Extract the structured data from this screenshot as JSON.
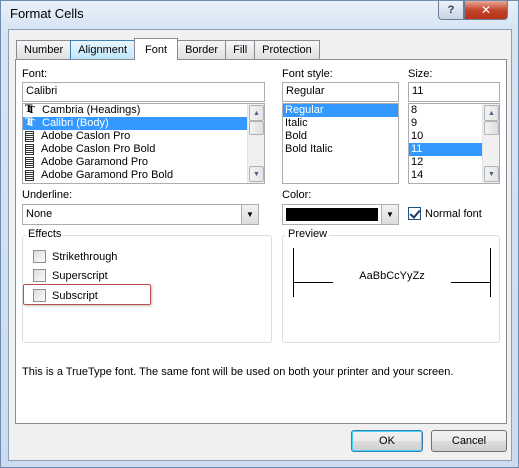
{
  "window": {
    "title": "Format Cells",
    "help_label": "?",
    "close_label": "✕"
  },
  "tabs": [
    {
      "label": "Number"
    },
    {
      "label": "Alignment"
    },
    {
      "label": "Font"
    },
    {
      "label": "Border"
    },
    {
      "label": "Fill"
    },
    {
      "label": "Protection"
    }
  ],
  "font": {
    "label": "Font:",
    "value": "Calibri",
    "items": [
      {
        "label": "Cambria (Headings)",
        "icon": "truetype-icon"
      },
      {
        "label": "Calibri (Body)",
        "icon": "truetype-icon",
        "selected": true
      },
      {
        "label": "Adobe Caslon Pro",
        "icon": "opentype-icon"
      },
      {
        "label": "Adobe Caslon Pro Bold",
        "icon": "opentype-icon"
      },
      {
        "label": "Adobe Garamond Pro",
        "icon": "opentype-icon"
      },
      {
        "label": "Adobe Garamond Pro Bold",
        "icon": "opentype-icon"
      }
    ]
  },
  "font_style": {
    "label": "Font style:",
    "value": "Regular",
    "items": [
      "Regular",
      "Italic",
      "Bold",
      "Bold Italic"
    ],
    "selected": "Regular"
  },
  "size": {
    "label": "Size:",
    "value": "11",
    "items": [
      "8",
      "9",
      "10",
      "11",
      "12",
      "14"
    ],
    "selected": "11"
  },
  "underline": {
    "label": "Underline:",
    "value": "None"
  },
  "color": {
    "label": "Color:",
    "value": "#000000"
  },
  "normal_font": {
    "label": "Normal font",
    "checked": true
  },
  "effects": {
    "title": "Effects",
    "strikethrough": {
      "label": "Strikethrough",
      "checked": false
    },
    "superscript": {
      "label": "Superscript",
      "checked": false
    },
    "subscript": {
      "label": "Subscript",
      "checked": false
    }
  },
  "preview": {
    "title": "Preview",
    "sample": "AaBbCcYyZz"
  },
  "info_text": "This is a TrueType font.  The same font will be used on both your printer and your screen.",
  "buttons": {
    "ok": "OK",
    "cancel": "Cancel"
  },
  "colors": {
    "selection": "#3399ff",
    "highlight_box": "#c0504d"
  }
}
